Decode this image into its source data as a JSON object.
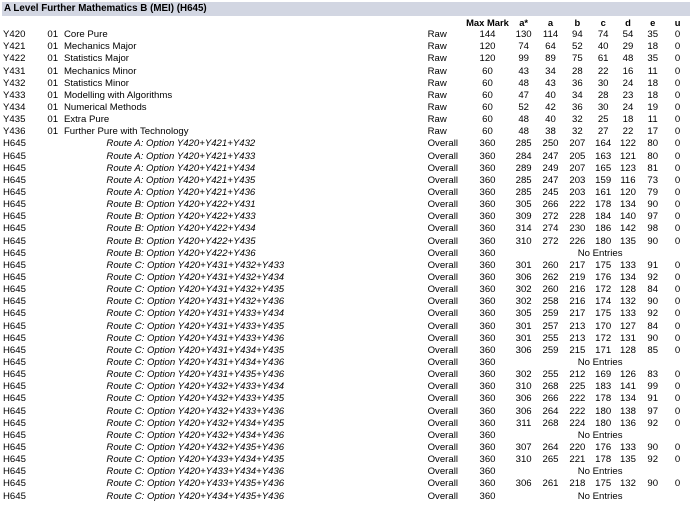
{
  "title": "A Level Further Mathematics B (MEI) (H645)",
  "headers": {
    "max": "Max Mark",
    "grades": [
      "a*",
      "a",
      "b",
      "c",
      "d",
      "e",
      "u"
    ]
  },
  "units": [
    {
      "code": "Y420",
      "opt": "01",
      "title": "Core Pure",
      "type": "Raw",
      "max": "144",
      "g": [
        "130",
        "114",
        "94",
        "74",
        "54",
        "35",
        "0"
      ]
    },
    {
      "code": "Y421",
      "opt": "01",
      "title": "Mechanics Major",
      "type": "Raw",
      "max": "120",
      "g": [
        "74",
        "64",
        "52",
        "40",
        "29",
        "18",
        "0"
      ]
    },
    {
      "code": "Y422",
      "opt": "01",
      "title": "Statistics Major",
      "type": "Raw",
      "max": "120",
      "g": [
        "99",
        "89",
        "75",
        "61",
        "48",
        "35",
        "0"
      ]
    },
    {
      "code": "Y431",
      "opt": "01",
      "title": "Mechanics Minor",
      "type": "Raw",
      "max": "60",
      "g": [
        "43",
        "34",
        "28",
        "22",
        "16",
        "11",
        "0"
      ]
    },
    {
      "code": "Y432",
      "opt": "01",
      "title": "Statistics Minor",
      "type": "Raw",
      "max": "60",
      "g": [
        "48",
        "43",
        "36",
        "30",
        "24",
        "18",
        "0"
      ]
    },
    {
      "code": "Y433",
      "opt": "01",
      "title": "Modelling with Algorithms",
      "type": "Raw",
      "max": "60",
      "g": [
        "47",
        "40",
        "34",
        "28",
        "23",
        "18",
        "0"
      ]
    },
    {
      "code": "Y434",
      "opt": "01",
      "title": "Numerical Methods",
      "type": "Raw",
      "max": "60",
      "g": [
        "52",
        "42",
        "36",
        "30",
        "24",
        "19",
        "0"
      ]
    },
    {
      "code": "Y435",
      "opt": "01",
      "title": "Extra Pure",
      "type": "Raw",
      "max": "60",
      "g": [
        "48",
        "40",
        "32",
        "25",
        "18",
        "11",
        "0"
      ]
    },
    {
      "code": "Y436",
      "opt": "01",
      "title": "Further Pure with Technology",
      "type": "Raw",
      "max": "60",
      "g": [
        "48",
        "38",
        "32",
        "27",
        "22",
        "17",
        "0"
      ]
    }
  ],
  "no_entries_text": "No Entries",
  "routes": [
    {
      "code": "H645",
      "title": "Route A: Option Y420+Y421+Y432",
      "type": "Overall",
      "max": "360",
      "g": [
        "285",
        "250",
        "207",
        "164",
        "122",
        "80",
        "0"
      ]
    },
    {
      "code": "H645",
      "title": "Route A: Option Y420+Y421+Y433",
      "type": "Overall",
      "max": "360",
      "g": [
        "284",
        "247",
        "205",
        "163",
        "121",
        "80",
        "0"
      ]
    },
    {
      "code": "H645",
      "title": "Route A: Option Y420+Y421+Y434",
      "type": "Overall",
      "max": "360",
      "g": [
        "289",
        "249",
        "207",
        "165",
        "123",
        "81",
        "0"
      ]
    },
    {
      "code": "H645",
      "title": "Route A: Option Y420+Y421+Y435",
      "type": "Overall",
      "max": "360",
      "g": [
        "285",
        "247",
        "203",
        "159",
        "116",
        "73",
        "0"
      ]
    },
    {
      "code": "H645",
      "title": "Route A: Option Y420+Y421+Y436",
      "type": "Overall",
      "max": "360",
      "g": [
        "285",
        "245",
        "203",
        "161",
        "120",
        "79",
        "0"
      ]
    },
    {
      "code": "H645",
      "title": "Route B: Option Y420+Y422+Y431",
      "type": "Overall",
      "max": "360",
      "g": [
        "305",
        "266",
        "222",
        "178",
        "134",
        "90",
        "0"
      ]
    },
    {
      "code": "H645",
      "title": "Route B: Option Y420+Y422+Y433",
      "type": "Overall",
      "max": "360",
      "g": [
        "309",
        "272",
        "228",
        "184",
        "140",
        "97",
        "0"
      ]
    },
    {
      "code": "H645",
      "title": "Route B: Option Y420+Y422+Y434",
      "type": "Overall",
      "max": "360",
      "g": [
        "314",
        "274",
        "230",
        "186",
        "142",
        "98",
        "0"
      ]
    },
    {
      "code": "H645",
      "title": "Route B: Option Y420+Y422+Y435",
      "type": "Overall",
      "max": "360",
      "g": [
        "310",
        "272",
        "226",
        "180",
        "135",
        "90",
        "0"
      ]
    },
    {
      "code": "H645",
      "title": "Route B: Option Y420+Y422+Y436",
      "type": "Overall",
      "max": "360",
      "g": null
    },
    {
      "code": "H645",
      "title": "Route C: Option Y420+Y431+Y432+Y433",
      "type": "Overall",
      "max": "360",
      "g": [
        "301",
        "260",
        "217",
        "175",
        "133",
        "91",
        "0"
      ]
    },
    {
      "code": "H645",
      "title": "Route C: Option Y420+Y431+Y432+Y434",
      "type": "Overall",
      "max": "360",
      "g": [
        "306",
        "262",
        "219",
        "176",
        "134",
        "92",
        "0"
      ]
    },
    {
      "code": "H645",
      "title": "Route C: Option Y420+Y431+Y432+Y435",
      "type": "Overall",
      "max": "360",
      "g": [
        "302",
        "260",
        "216",
        "172",
        "128",
        "84",
        "0"
      ]
    },
    {
      "code": "H645",
      "title": "Route C: Option Y420+Y431+Y432+Y436",
      "type": "Overall",
      "max": "360",
      "g": [
        "302",
        "258",
        "216",
        "174",
        "132",
        "90",
        "0"
      ]
    },
    {
      "code": "H645",
      "title": "Route C: Option Y420+Y431+Y433+Y434",
      "type": "Overall",
      "max": "360",
      "g": [
        "305",
        "259",
        "217",
        "175",
        "133",
        "92",
        "0"
      ]
    },
    {
      "code": "H645",
      "title": "Route C: Option Y420+Y431+Y433+Y435",
      "type": "Overall",
      "max": "360",
      "g": [
        "301",
        "257",
        "213",
        "170",
        "127",
        "84",
        "0"
      ]
    },
    {
      "code": "H645",
      "title": "Route C: Option Y420+Y431+Y433+Y436",
      "type": "Overall",
      "max": "360",
      "g": [
        "301",
        "255",
        "213",
        "172",
        "131",
        "90",
        "0"
      ]
    },
    {
      "code": "H645",
      "title": "Route C: Option Y420+Y431+Y434+Y435",
      "type": "Overall",
      "max": "360",
      "g": [
        "306",
        "259",
        "215",
        "171",
        "128",
        "85",
        "0"
      ]
    },
    {
      "code": "H645",
      "title": "Route C: Option Y420+Y431+Y434+Y436",
      "type": "Overall",
      "max": "360",
      "g": null
    },
    {
      "code": "H645",
      "title": "Route C: Option Y420+Y431+Y435+Y436",
      "type": "Overall",
      "max": "360",
      "g": [
        "302",
        "255",
        "212",
        "169",
        "126",
        "83",
        "0"
      ]
    },
    {
      "code": "H645",
      "title": "Route C: Option Y420+Y432+Y433+Y434",
      "type": "Overall",
      "max": "360",
      "g": [
        "310",
        "268",
        "225",
        "183",
        "141",
        "99",
        "0"
      ]
    },
    {
      "code": "H645",
      "title": "Route C: Option Y420+Y432+Y433+Y435",
      "type": "Overall",
      "max": "360",
      "g": [
        "306",
        "266",
        "222",
        "178",
        "134",
        "91",
        "0"
      ]
    },
    {
      "code": "H645",
      "title": "Route C: Option Y420+Y432+Y433+Y436",
      "type": "Overall",
      "max": "360",
      "g": [
        "306",
        "264",
        "222",
        "180",
        "138",
        "97",
        "0"
      ]
    },
    {
      "code": "H645",
      "title": "Route C: Option Y420+Y432+Y434+Y435",
      "type": "Overall",
      "max": "360",
      "g": [
        "311",
        "268",
        "224",
        "180",
        "136",
        "92",
        "0"
      ]
    },
    {
      "code": "H645",
      "title": "Route C: Option Y420+Y432+Y434+Y436",
      "type": "Overall",
      "max": "360",
      "g": null
    },
    {
      "code": "H645",
      "title": "Route C: Option Y420+Y432+Y435+Y436",
      "type": "Overall",
      "max": "360",
      "g": [
        "307",
        "264",
        "220",
        "176",
        "133",
        "90",
        "0"
      ]
    },
    {
      "code": "H645",
      "title": "Route C: Option Y420+Y433+Y434+Y435",
      "type": "Overall",
      "max": "360",
      "g": [
        "310",
        "265",
        "221",
        "178",
        "135",
        "92",
        "0"
      ]
    },
    {
      "code": "H645",
      "title": "Route C: Option Y420+Y433+Y434+Y436",
      "type": "Overall",
      "max": "360",
      "g": null
    },
    {
      "code": "H645",
      "title": "Route C: Option Y420+Y433+Y435+Y436",
      "type": "Overall",
      "max": "360",
      "g": [
        "306",
        "261",
        "218",
        "175",
        "132",
        "90",
        "0"
      ]
    },
    {
      "code": "H645",
      "title": "Route C: Option Y420+Y434+Y435+Y436",
      "type": "Overall",
      "max": "360",
      "g": null
    }
  ]
}
